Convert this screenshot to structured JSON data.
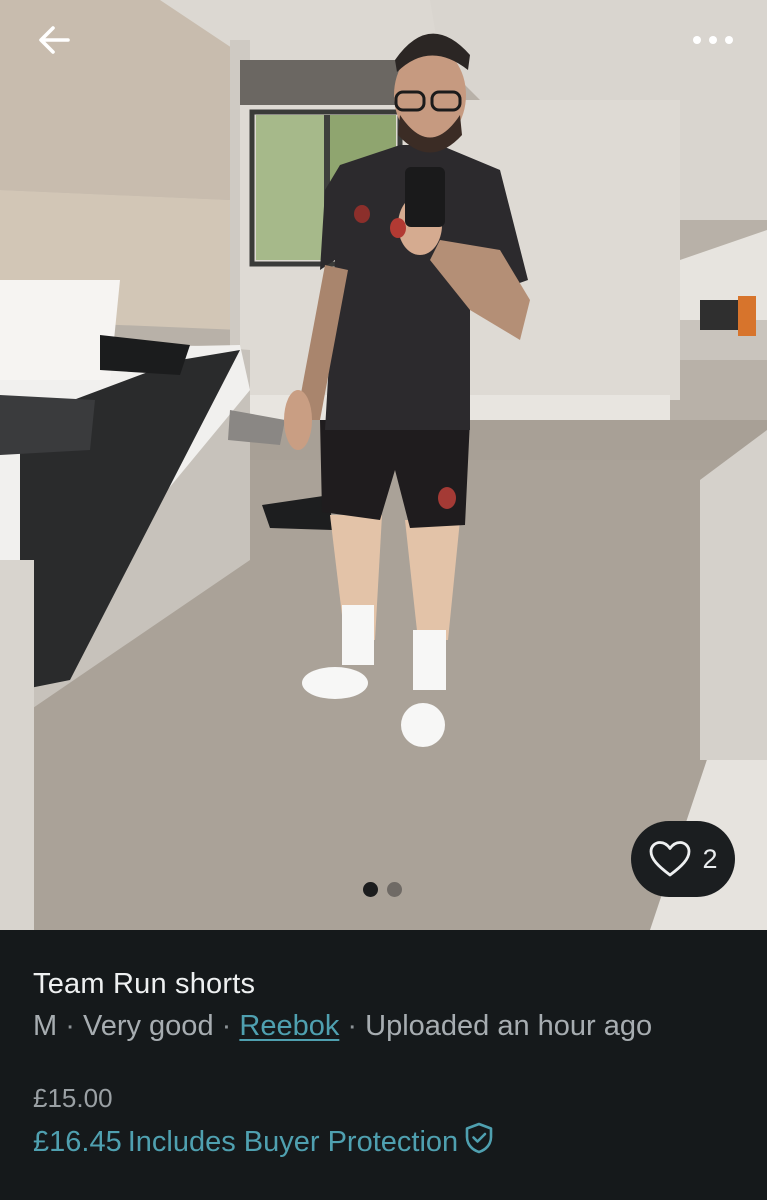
{
  "item": {
    "title": "Team Run shorts",
    "size": "M",
    "condition": "Very good",
    "brand": "Reebok",
    "uploaded": "Uploaded an hour ago",
    "separator": "·"
  },
  "pricing": {
    "price": "£15.00",
    "total_price": "£16.45",
    "protection_label": "Includes Buyer Protection"
  },
  "favorites": {
    "count": "2"
  },
  "gallery": {
    "photo_count": 2,
    "active_index": 0
  },
  "icons": {
    "back": "arrow-left-icon",
    "more": "more-horizontal-icon",
    "favorite": "heart-outline-icon",
    "protection": "shield-check-icon"
  },
  "colors": {
    "panel_bg": "#15191b",
    "accent": "#4fa0b0",
    "title_text": "#eef0f1",
    "meta_text": "#a7adb1"
  }
}
